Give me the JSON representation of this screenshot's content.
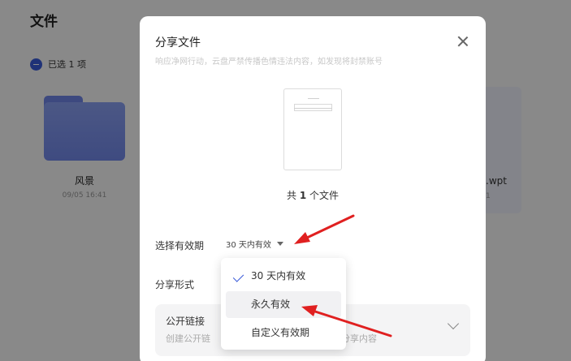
{
  "background": {
    "page_title": "文件",
    "selected_text": "已选 1 项",
    "folder": {
      "name": "风景",
      "date": "09/05 16:41"
    },
    "right_card": {
      "name_fragment": ".wpt",
      "date_fragment": "1"
    }
  },
  "modal": {
    "title": "分享文件",
    "notice": "响应净网行动，云盘严禁传播色情违法内容，如发现将封禁账号",
    "file_count_prefix": "共 ",
    "file_count_num": "1",
    "file_count_suffix": " 个文件",
    "expiry_label": "选择有效期",
    "expiry_value": "30 天内有效",
    "share_form_label": "分享形式",
    "public_link": {
      "title": "公开链接",
      "desc_left": "创建公开链",
      "desc_right": "分享内容"
    }
  },
  "dropdown": {
    "items": [
      {
        "label": "30 天内有效",
        "checked": true
      },
      {
        "label": "永久有效",
        "checked": false
      },
      {
        "label": "自定义有效期",
        "checked": false
      }
    ]
  },
  "colors": {
    "accent": "#3a5bd9",
    "arrow": "#e02020"
  }
}
